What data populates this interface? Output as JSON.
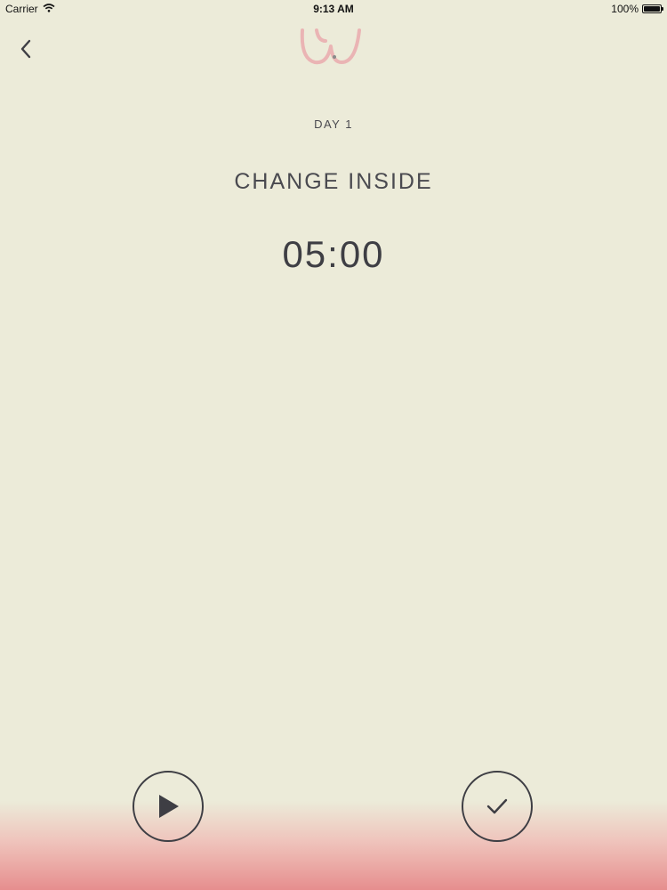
{
  "status_bar": {
    "carrier": "Carrier",
    "time": "9:13 AM",
    "battery": "100%",
    "battery_level": 1.0
  },
  "nav": {
    "back_icon": "chevron-left-icon",
    "logo_icon": "brand-logo-icon"
  },
  "session": {
    "day_label": "DAY 1",
    "title": "CHANGE INSIDE",
    "timer": "05:00"
  },
  "controls": {
    "play_icon": "play-icon",
    "done_icon": "checkmark-icon"
  },
  "colors": {
    "background": "#ecebd9",
    "text": "#3e3e44",
    "logo": "#eab4b4",
    "gradient_bottom": "#e68e8e"
  }
}
